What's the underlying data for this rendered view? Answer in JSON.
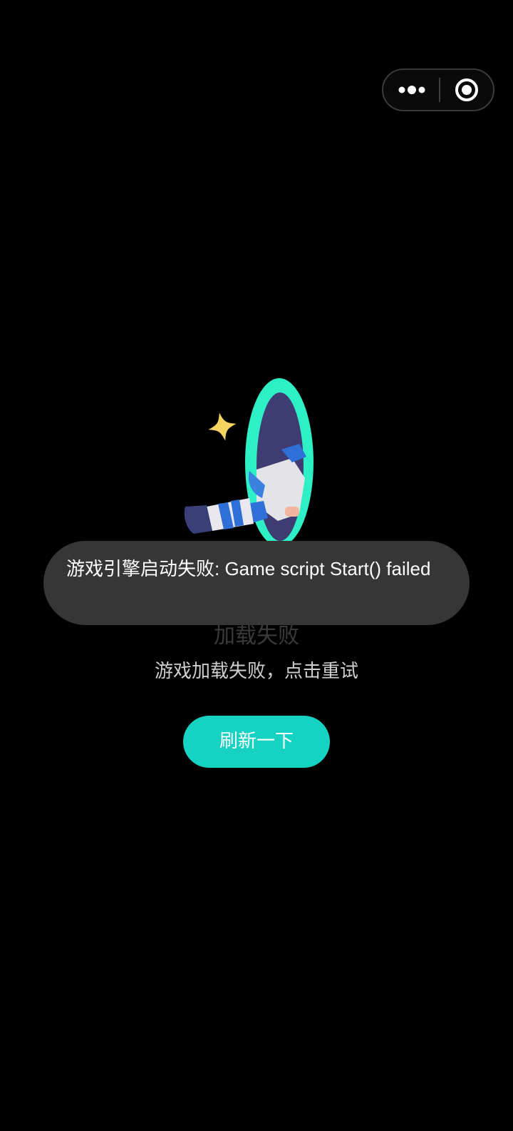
{
  "capsule": {
    "more_icon": "more-dots-icon",
    "close_icon": "target-circle-icon"
  },
  "illustration": {
    "description_icon": "portal-telescope-illustration"
  },
  "error": {
    "title": "加载失败",
    "description": "游戏加载失败，点击重试",
    "retry_button": "刷新一下"
  },
  "toast": {
    "message": "游戏引擎启动失败: Game script Start() failed"
  },
  "colors": {
    "background": "#000000",
    "accent": "#15d2c2",
    "toast_bg": "#363636",
    "portal_ring": "#2ef0c6",
    "star": "#f6d45f"
  }
}
